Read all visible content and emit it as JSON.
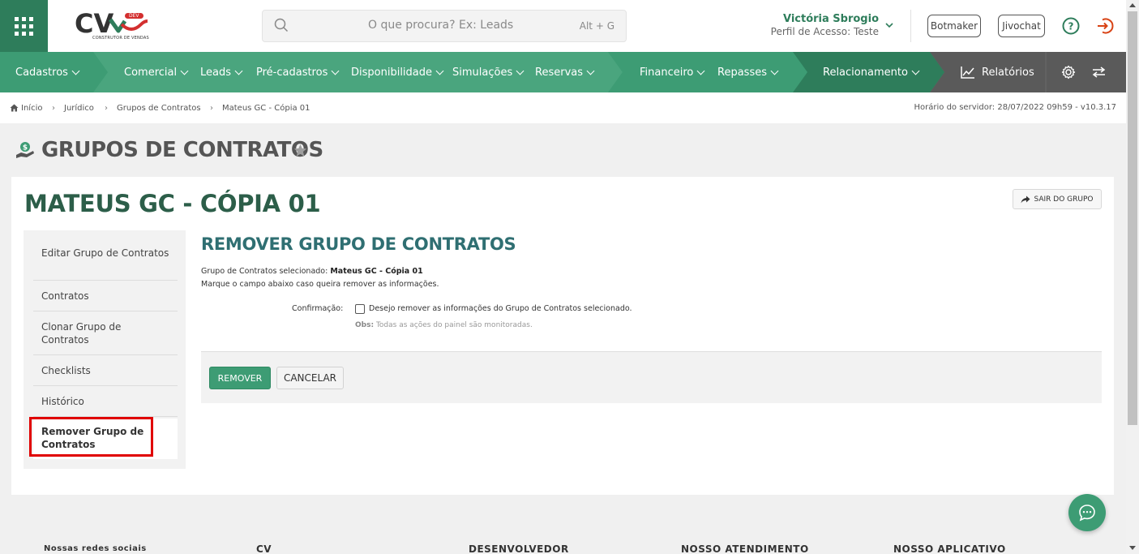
{
  "header": {
    "search_placeholder": "O que procura? Ex: Leads",
    "search_shortcut": "Alt + G",
    "logo_text": "CV",
    "logo_sub": "CONSTRUTOR DE VENDAS",
    "logo_badge": "DEV",
    "user_name": "Victória Sbrogio",
    "user_profile": "Perfil de Acesso: Teste",
    "botmaker_label": "Botmaker",
    "jivochat_label": "Jivochat"
  },
  "nav": {
    "items": [
      {
        "label": "Cadastros"
      },
      {
        "label": "Comercial"
      },
      {
        "label": "Leads"
      },
      {
        "label": "Pré-cadastros"
      },
      {
        "label": "Disponibilidade"
      },
      {
        "label": "Simulações"
      },
      {
        "label": "Reservas"
      },
      {
        "label": "Financeiro"
      },
      {
        "label": "Repasses"
      },
      {
        "label": "Relacionamento"
      }
    ],
    "reports_label": "Relatórios"
  },
  "breadcrumb": {
    "items": [
      "Início",
      "Jurídico",
      "Grupos de Contratos",
      "Mateus GC - Cópia 01"
    ],
    "server_time": "Horário do servidor: 28/07/2022 09h59 - v10.3.17"
  },
  "page": {
    "title": "GRUPOS DE CONTRATOS",
    "group_title": "MATEUS GC - CÓPIA 01",
    "exit_label": "SAIR DO GRUPO"
  },
  "sidebar": {
    "items": [
      {
        "label": "Editar Grupo de Contratos"
      },
      {
        "label": "Contratos"
      },
      {
        "label": "Clonar Grupo de Contratos"
      },
      {
        "label": "Checklists"
      },
      {
        "label": "Histórico"
      },
      {
        "label": "Remover Grupo de Contratos"
      }
    ]
  },
  "content": {
    "section_title": "REMOVER GRUPO DE CONTRATOS",
    "selected_prefix": "Grupo de Contratos selecionado:",
    "selected_value": "Mateus GC - Cópia 01",
    "instruction": "Marque o campo abaixo caso queira remover as informações.",
    "confirm_label": "Confirmação:",
    "confirm_text": "Desejo remover as informações do Grupo de Contratos selecionado.",
    "obs_label": "Obs:",
    "obs_text": "Todas as ações do painel são monitoradas.",
    "remove_label": "REMOVER",
    "cancel_label": "CANCELAR"
  },
  "footer": {
    "cols": [
      "Nossas redes sociais",
      "CV",
      "DESENVOLVEDOR",
      "NOSSO ATENDIMENTO",
      "NOSSO APLICATIVO"
    ]
  },
  "colors": {
    "brand_green": "#3d9c74",
    "dark_green": "#2e7d5b",
    "title_green": "#2c5e49",
    "highlight_red": "#e00000"
  }
}
